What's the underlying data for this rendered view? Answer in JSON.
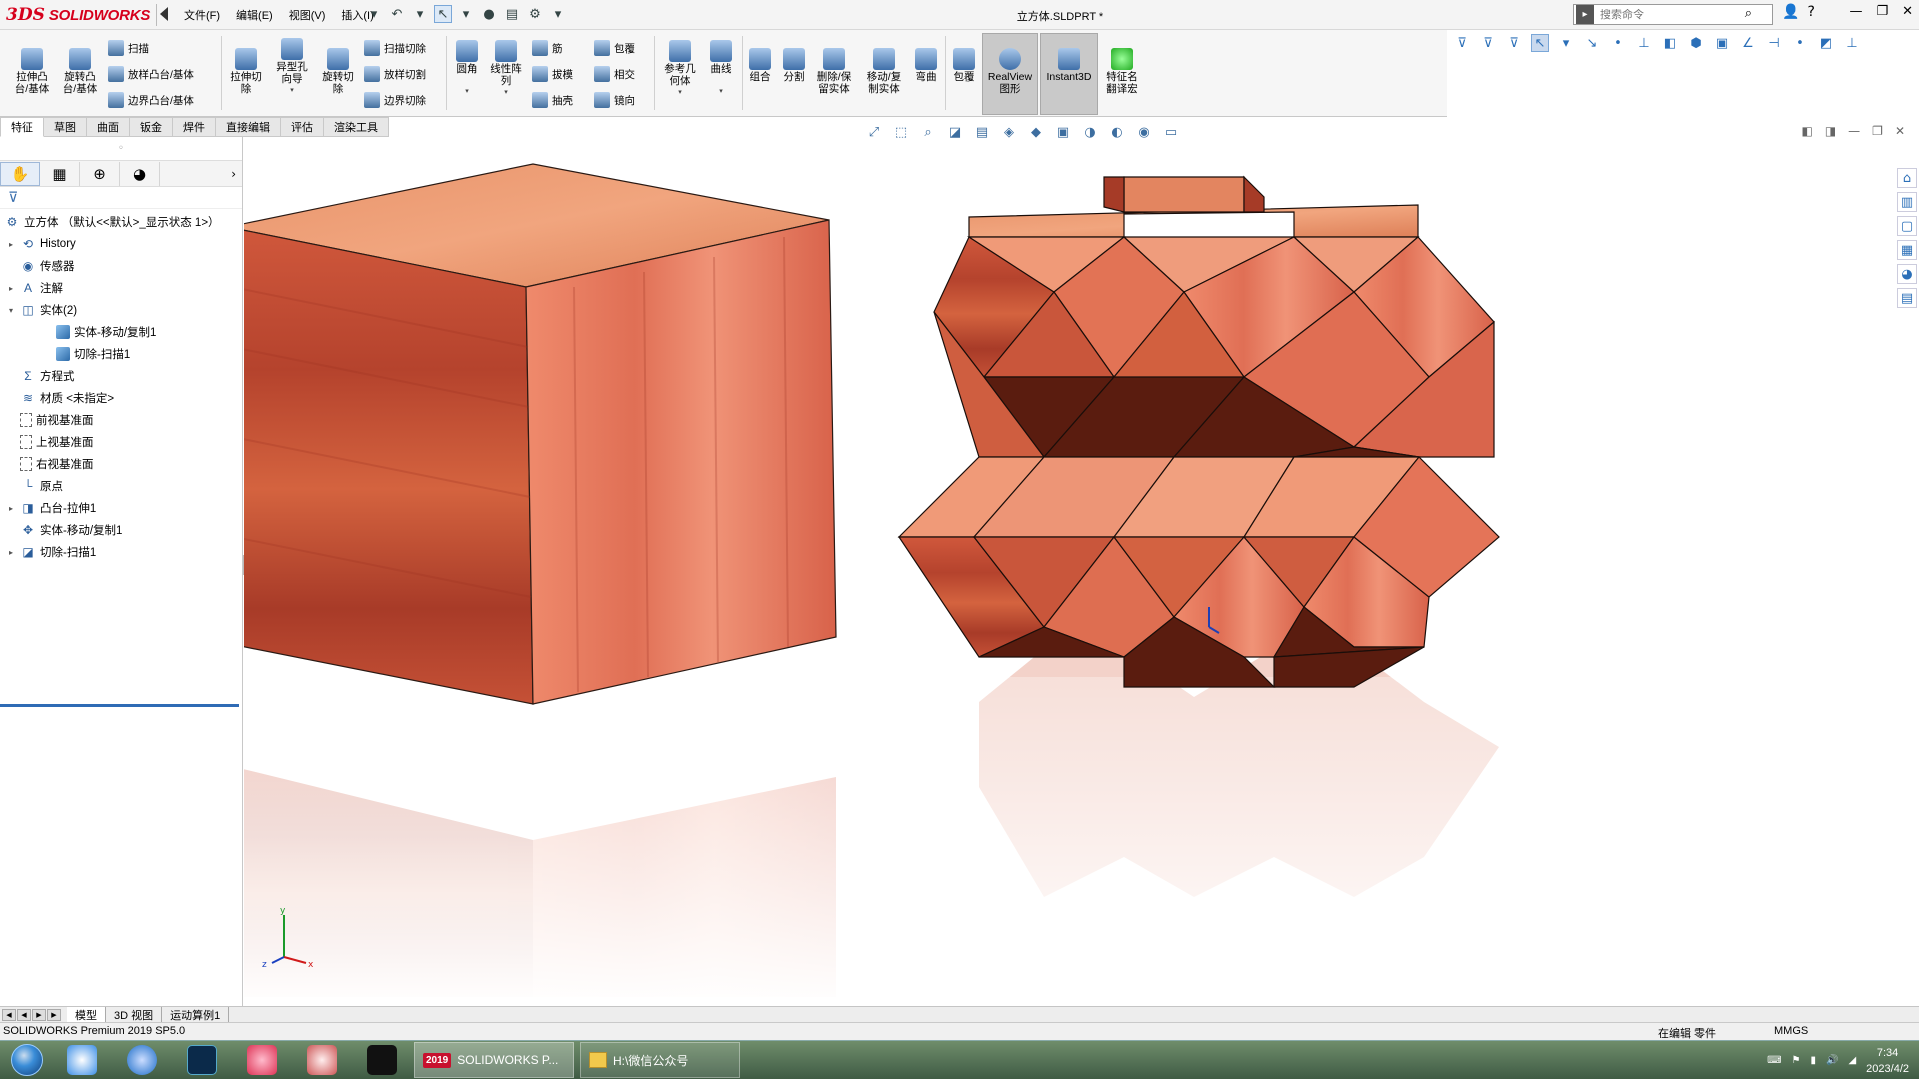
{
  "app": {
    "logo_ds": "3DS",
    "logo_text": "SOLIDWORKS",
    "document_title": "立方体.SLDPRT *"
  },
  "menu": [
    "文件(F)",
    "编辑(E)",
    "视图(V)",
    "插入(I)"
  ],
  "search": {
    "placeholder": "搜索命令"
  },
  "ribbon": {
    "features": {
      "extrude_boss": "拉伸凸\n台/基体",
      "revolve_boss": "旋转凸\n台/基体",
      "sweep": "扫描",
      "loft": "放样凸台/基体",
      "boundary_boss": "边界凸台/基体",
      "extrude_cut": "拉伸切\n除",
      "hole_wizard": "异型孔\n向导",
      "revolve_cut": "旋转切\n除",
      "sweep_cut": "扫描切除",
      "loft_cut": "放样切割",
      "boundary_cut": "边界切除",
      "fillet": "圆角",
      "linear_pattern": "线性阵\n列",
      "rib": "筋",
      "draft": "拔模",
      "shell": "抽壳",
      "wrap": "包覆",
      "intersect": "相交",
      "mirror": "镜向",
      "ref_geometry": "参考几\n何体",
      "curves": "曲线",
      "combine": "组合",
      "split": "分割",
      "delete_keep_body": "删除/保\n留实体",
      "move_copy_body": "移动/复\n制实体",
      "flex": "弯曲",
      "wrap2": "包覆",
      "realview": "RealView\n图形",
      "instant3d": "Instant3D",
      "feature_names": "特征名\n翻译宏"
    }
  },
  "tabs": [
    "特征",
    "草图",
    "曲面",
    "钣金",
    "焊件",
    "直接编辑",
    "评估",
    "渲染工具"
  ],
  "tree": {
    "root": "立方体 （默认<<默认>_显示状态 1>）",
    "items": [
      {
        "label": "History",
        "level": 1,
        "twisty": "▸",
        "icon": "history-icon"
      },
      {
        "label": "传感器",
        "level": 1,
        "twisty": "",
        "icon": "sensor-icon"
      },
      {
        "label": "注解",
        "level": 1,
        "twisty": "▸",
        "icon": "annotation-icon"
      },
      {
        "label": "实体(2)",
        "level": 1,
        "twisty": "▾",
        "icon": "solid-bodies-icon"
      },
      {
        "label": "实体-移动/复制1",
        "level": 2,
        "twisty": "",
        "icon": "body-icon"
      },
      {
        "label": "切除-扫描1",
        "level": 2,
        "twisty": "",
        "icon": "body-icon"
      },
      {
        "label": "方程式",
        "level": 1,
        "twisty": "",
        "icon": "equation-icon"
      },
      {
        "label": "材质 <未指定>",
        "level": 1,
        "twisty": "",
        "icon": "material-icon"
      },
      {
        "label": "前视基准面",
        "level": 1,
        "twisty": "",
        "icon": "plane-icon"
      },
      {
        "label": "上视基准面",
        "level": 1,
        "twisty": "",
        "icon": "plane-icon"
      },
      {
        "label": "右视基准面",
        "level": 1,
        "twisty": "",
        "icon": "plane-icon"
      },
      {
        "label": "原点",
        "level": 1,
        "twisty": "",
        "icon": "origin-icon"
      },
      {
        "label": "凸台-拉伸1",
        "level": 1,
        "twisty": "▸",
        "icon": "extrude-icon"
      },
      {
        "label": "实体-移动/复制1",
        "level": 1,
        "twisty": "",
        "icon": "move-copy-icon"
      },
      {
        "label": "切除-扫描1",
        "level": 1,
        "twisty": "▸",
        "icon": "sweep-cut-icon"
      }
    ]
  },
  "bottom_tabs": [
    "模型",
    "3D 视图",
    "运动算例1"
  ],
  "status": {
    "left": "SOLIDWORKS Premium 2019 SP5.0",
    "mode": "在编辑 零件",
    "units": "MMGS"
  },
  "taskbar": {
    "sw_task": "SOLIDWORKS P...",
    "sw_badge": "2019",
    "folder_task": "H:\\微信公众号",
    "time": "7:34",
    "date": "2023/4/2"
  },
  "triad": {
    "x": "x",
    "y": "y",
    "z": "z"
  },
  "colors": {
    "accent": "#2f6bb5",
    "brand": "#d6001c",
    "wood": "#d95f3f"
  }
}
